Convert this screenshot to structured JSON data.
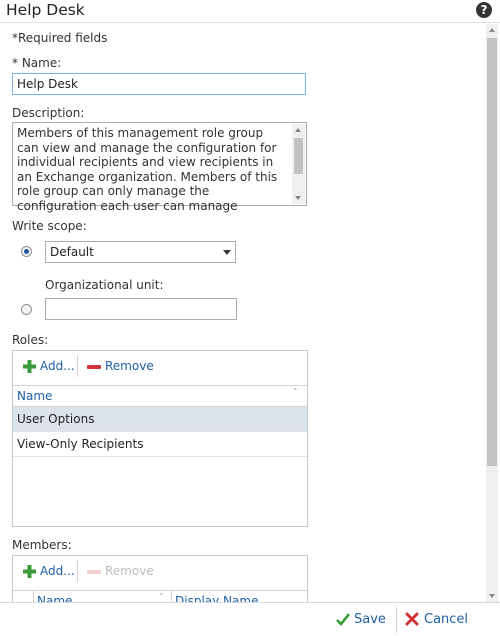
{
  "window": {
    "title": "Help Desk",
    "help_icon": "question-circle-icon"
  },
  "form": {
    "required_note": "*Required fields",
    "name_label": "* Name:",
    "name_value": "Help Desk",
    "description_label": "Description:",
    "description_value": "Members of this management role group can view and manage the configuration for individual recipients and view recipients in an Exchange organization. Members of this role group can only manage the configuration each user can manage",
    "write_scope_label": "Write scope:",
    "write_scope_value": "Default",
    "org_unit_label": "Organizational unit:",
    "org_unit_value": ""
  },
  "roles": {
    "label": "Roles:",
    "add_label": "Add...",
    "remove_label": "Remove",
    "column": "Name",
    "rows": [
      "User Options",
      "View-Only Recipients"
    ]
  },
  "members": {
    "label": "Members:",
    "add_label": "Add...",
    "remove_label": "Remove",
    "columns": [
      "Name",
      "Display Name"
    ]
  },
  "footer": {
    "save_label": "Save",
    "cancel_label": "Cancel"
  },
  "colors": {
    "accent": "#1e5fa6",
    "add_green": "#3a9a3a",
    "remove_red": "#d0343a",
    "selected_row": "#dce3ec"
  }
}
